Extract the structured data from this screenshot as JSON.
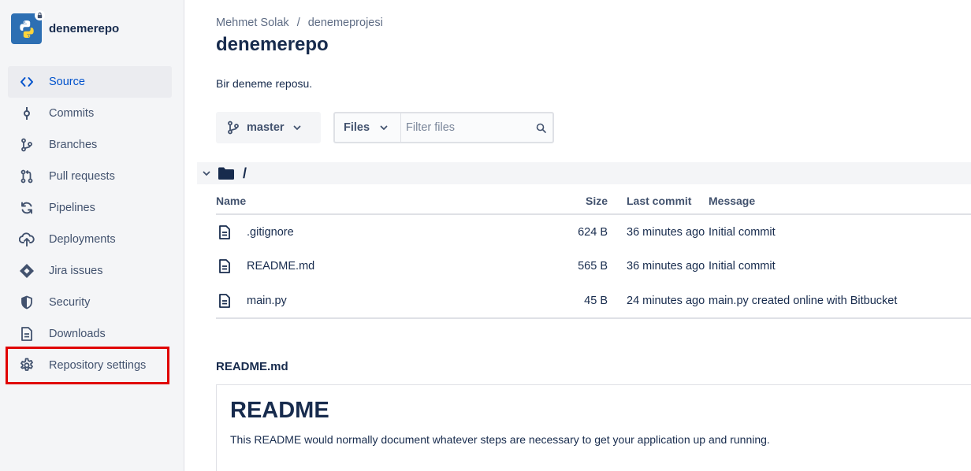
{
  "sidebar": {
    "repo_name": "denemerepo",
    "items": [
      {
        "label": "Source",
        "icon": "code-icon",
        "active": true
      },
      {
        "label": "Commits",
        "icon": "commit-icon"
      },
      {
        "label": "Branches",
        "icon": "branch-icon"
      },
      {
        "label": "Pull requests",
        "icon": "pull-request-icon"
      },
      {
        "label": "Pipelines",
        "icon": "pipelines-icon"
      },
      {
        "label": "Deployments",
        "icon": "cloud-upload-icon"
      },
      {
        "label": "Jira issues",
        "icon": "jira-icon"
      },
      {
        "label": "Security",
        "icon": "shield-icon"
      },
      {
        "label": "Downloads",
        "icon": "document-icon"
      },
      {
        "label": "Repository settings",
        "icon": "gear-icon"
      }
    ]
  },
  "header": {
    "breadcrumb": [
      "Mehmet Solak",
      "denemeprojesi"
    ],
    "breadcrumb_separator": "/",
    "title": "denemerepo",
    "description": "Bir deneme reposu."
  },
  "toolbar": {
    "branch": "master",
    "files_select": "Files",
    "filter_placeholder": "Filter files"
  },
  "directory": {
    "path": "/"
  },
  "table": {
    "columns": [
      "Name",
      "Size",
      "Last commit",
      "Message"
    ],
    "rows": [
      {
        "name": ".gitignore",
        "size": "624 B",
        "last_commit": "36 minutes ago",
        "message": "Initial commit"
      },
      {
        "name": "README.md",
        "size": "565 B",
        "last_commit": "36 minutes ago",
        "message": "Initial commit"
      },
      {
        "name": "main.py",
        "size": "45 B",
        "last_commit": "24 minutes ago",
        "message": "main.py created online with Bitbucket"
      }
    ]
  },
  "readme": {
    "filename": "README.md",
    "title": "README",
    "text": "This README would normally document whatever steps are necessary to get your application up and running."
  },
  "colors": {
    "accent": "#0052cc",
    "highlight": "#e00000",
    "sidebar_bg": "#f4f5f7"
  }
}
